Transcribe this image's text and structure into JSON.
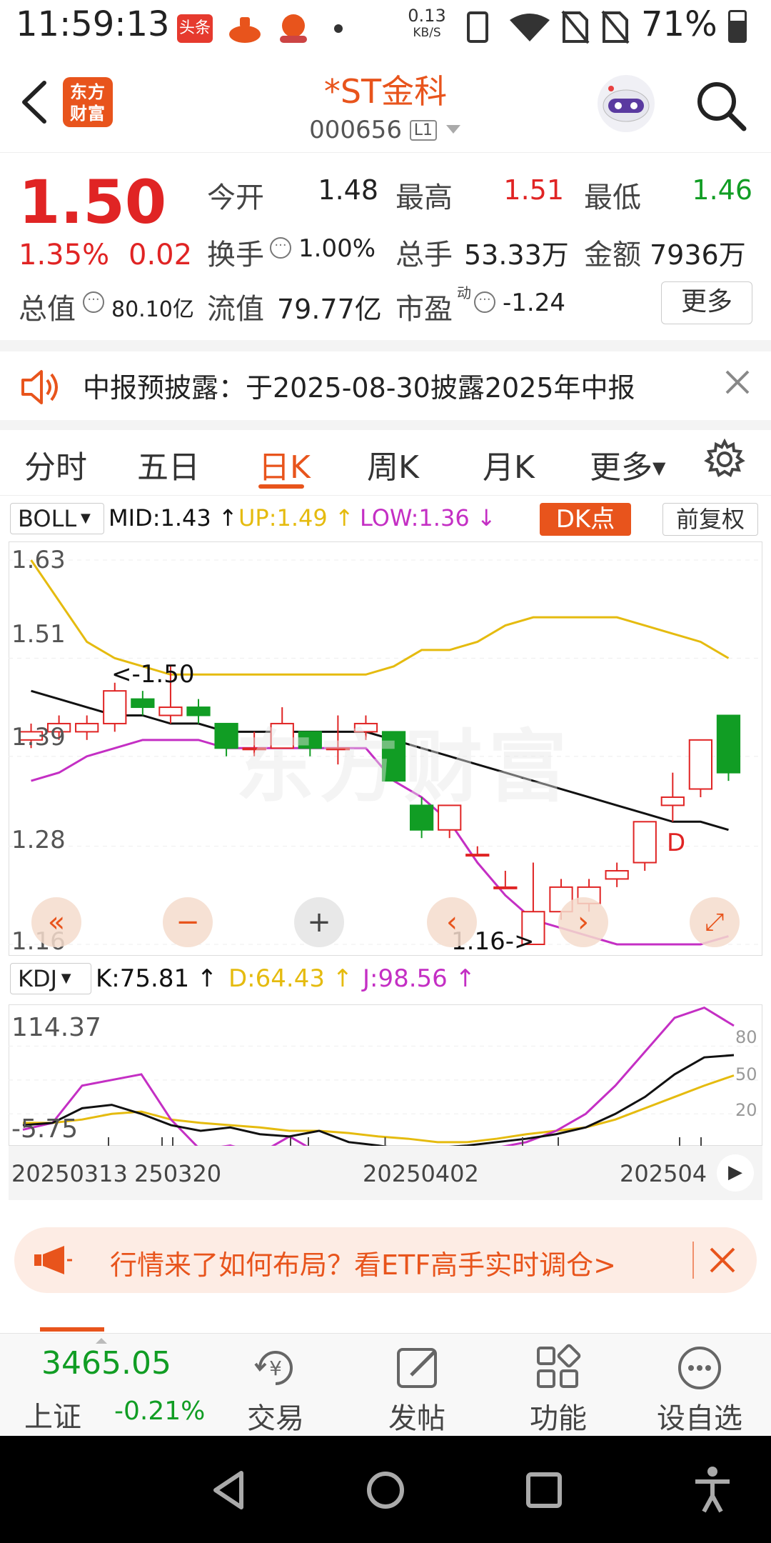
{
  "status_bar": {
    "time": "11:59:13",
    "net_speed_value": "0.13",
    "net_speed_unit": "KB/S",
    "battery": "71%",
    "app_icons": [
      "toutiao-icon",
      "app-icon",
      "app-icon"
    ]
  },
  "header": {
    "logo_text": "东方财富",
    "stock_name": "*ST金科",
    "stock_code": "000656",
    "level": "L1"
  },
  "quote": {
    "price": "1.50",
    "change_pct": "1.35%",
    "change_amt": "0.02",
    "open_label": "今开",
    "open_value": "1.48",
    "high_label": "最高",
    "high_value": "1.51",
    "low_label": "最低",
    "low_value": "1.46",
    "turnover_label": "换手",
    "turnover_value": "1.00%",
    "volume_label": "总手",
    "volume_value": "53.33万",
    "amount_label": "金额",
    "amount_value": "7936万",
    "mktcap_label": "总值",
    "mktcap_value": "80.10亿",
    "float_label": "流值",
    "float_value": "79.77亿",
    "pe_label": "市盈",
    "pe_sup": "动",
    "pe_value": "-1.24",
    "more_button": "更多"
  },
  "notice": {
    "text": "中报预披露：于2025-08-30披露2025年中报"
  },
  "tabs": {
    "items": [
      "分时",
      "五日",
      "日K",
      "周K",
      "月K",
      "更多"
    ],
    "active_index": 2
  },
  "boll": {
    "selector": "BOLL",
    "mid": "MID:1.43",
    "up": "UP:1.49",
    "low": "LOW:1.36",
    "dk_button": "DK点",
    "adjust_button": "前复权",
    "y_labels": [
      "1.63",
      "1.51",
      "1.39",
      "1.28",
      "1.16"
    ],
    "high_marker": "<-1.50",
    "low_marker": "1.16->",
    "d_marker": "D",
    "watermark": "东方财富",
    "colors": {
      "mid": "#111111",
      "up": "#e5bb0f",
      "low": "#c42fc4",
      "rise": "#e02424",
      "fall": "#119d24"
    }
  },
  "kdj": {
    "selector": "KDJ",
    "k": "K:75.81",
    "d": "D:64.43",
    "j": "J:98.56",
    "y_max": "114.37",
    "y_min": "-5.75",
    "right_ticks": [
      "80",
      "50",
      "20"
    ],
    "x_labels": [
      "20250313",
      "250320",
      "20250402",
      "202504"
    ]
  },
  "chart_data": {
    "type": "candlestick",
    "ylim": [
      1.16,
      1.63
    ],
    "candles": [
      {
        "o": 1.41,
        "c": 1.42,
        "h": 1.43,
        "l": 1.4
      },
      {
        "o": 1.42,
        "c": 1.43,
        "h": 1.44,
        "l": 1.41
      },
      {
        "o": 1.42,
        "c": 1.43,
        "h": 1.44,
        "l": 1.41
      },
      {
        "o": 1.43,
        "c": 1.47,
        "h": 1.48,
        "l": 1.42
      },
      {
        "o": 1.46,
        "c": 1.45,
        "h": 1.47,
        "l": 1.44
      },
      {
        "o": 1.44,
        "c": 1.45,
        "h": 1.5,
        "l": 1.43
      },
      {
        "o": 1.45,
        "c": 1.44,
        "h": 1.46,
        "l": 1.43
      },
      {
        "o": 1.43,
        "c": 1.4,
        "h": 1.43,
        "l": 1.39
      },
      {
        "o": 1.4,
        "c": 1.4,
        "h": 1.42,
        "l": 1.39
      },
      {
        "o": 1.4,
        "c": 1.43,
        "h": 1.45,
        "l": 1.4
      },
      {
        "o": 1.42,
        "c": 1.4,
        "h": 1.42,
        "l": 1.39
      },
      {
        "o": 1.4,
        "c": 1.4,
        "h": 1.44,
        "l": 1.38
      },
      {
        "o": 1.42,
        "c": 1.43,
        "h": 1.44,
        "l": 1.41
      },
      {
        "o": 1.42,
        "c": 1.36,
        "h": 1.42,
        "l": 1.36
      },
      {
        "o": 1.33,
        "c": 1.3,
        "h": 1.34,
        "l": 1.29
      },
      {
        "o": 1.3,
        "c": 1.33,
        "h": 1.33,
        "l": 1.29
      },
      {
        "o": 1.27,
        "c": 1.27,
        "h": 1.28,
        "l": 1.27
      },
      {
        "o": 1.23,
        "c": 1.23,
        "h": 1.25,
        "l": 1.23
      },
      {
        "o": 1.16,
        "c": 1.2,
        "h": 1.26,
        "l": 1.16
      },
      {
        "o": 1.2,
        "c": 1.23,
        "h": 1.24,
        "l": 1.19
      },
      {
        "o": 1.21,
        "c": 1.23,
        "h": 1.24,
        "l": 1.2
      },
      {
        "o": 1.24,
        "c": 1.25,
        "h": 1.26,
        "l": 1.23
      },
      {
        "o": 1.26,
        "c": 1.31,
        "h": 1.31,
        "l": 1.25
      },
      {
        "o": 1.33,
        "c": 1.34,
        "h": 1.37,
        "l": 1.31
      },
      {
        "o": 1.35,
        "c": 1.41,
        "h": 1.41,
        "l": 1.34
      },
      {
        "o": 1.44,
        "c": 1.37,
        "h": 1.44,
        "l": 1.36
      }
    ],
    "boll_mid": [
      1.47,
      1.46,
      1.45,
      1.44,
      1.44,
      1.43,
      1.43,
      1.42,
      1.42,
      1.42,
      1.42,
      1.42,
      1.42,
      1.41,
      1.4,
      1.39,
      1.38,
      1.37,
      1.36,
      1.35,
      1.34,
      1.33,
      1.32,
      1.31,
      1.31,
      1.3
    ],
    "boll_up": [
      1.63,
      1.58,
      1.53,
      1.51,
      1.5,
      1.49,
      1.49,
      1.49,
      1.49,
      1.49,
      1.49,
      1.49,
      1.49,
      1.5,
      1.52,
      1.52,
      1.53,
      1.55,
      1.56,
      1.56,
      1.56,
      1.56,
      1.55,
      1.54,
      1.53,
      1.51
    ],
    "boll_low": [
      1.36,
      1.37,
      1.39,
      1.4,
      1.41,
      1.41,
      1.41,
      1.4,
      1.4,
      1.4,
      1.4,
      1.4,
      1.4,
      1.36,
      1.34,
      1.31,
      1.26,
      1.22,
      1.19,
      1.18,
      1.17,
      1.16,
      1.16,
      1.16,
      1.16,
      1.17
    ],
    "kdj_ylim": [
      -5.75,
      114.37
    ],
    "kdj_k": [
      10,
      12,
      25,
      28,
      20,
      10,
      5,
      8,
      2,
      0,
      5,
      -5,
      -8,
      -12,
      -10,
      -8,
      -5,
      -2,
      2,
      8,
      20,
      35,
      55,
      70,
      72
    ],
    "kdj_d": [
      12,
      12,
      15,
      20,
      22,
      15,
      12,
      10,
      8,
      5,
      5,
      3,
      0,
      -2,
      -5,
      -5,
      -2,
      2,
      5,
      8,
      15,
      25,
      35,
      45,
      54
    ],
    "kdj_j": [
      6,
      12,
      45,
      50,
      55,
      15,
      -12,
      -8,
      -15,
      0,
      -15,
      -20,
      -25,
      -18,
      -15,
      -25,
      -10,
      -5,
      5,
      20,
      45,
      75,
      105,
      114,
      98
    ]
  },
  "promo": {
    "text": "行情来了如何布局？看ETF高手实时调仓>"
  },
  "bottom_nav": {
    "index_value": "3465.05",
    "index_name": "上证",
    "index_change": "-0.21%",
    "items": [
      "交易",
      "发帖",
      "功能",
      "设自选"
    ]
  }
}
